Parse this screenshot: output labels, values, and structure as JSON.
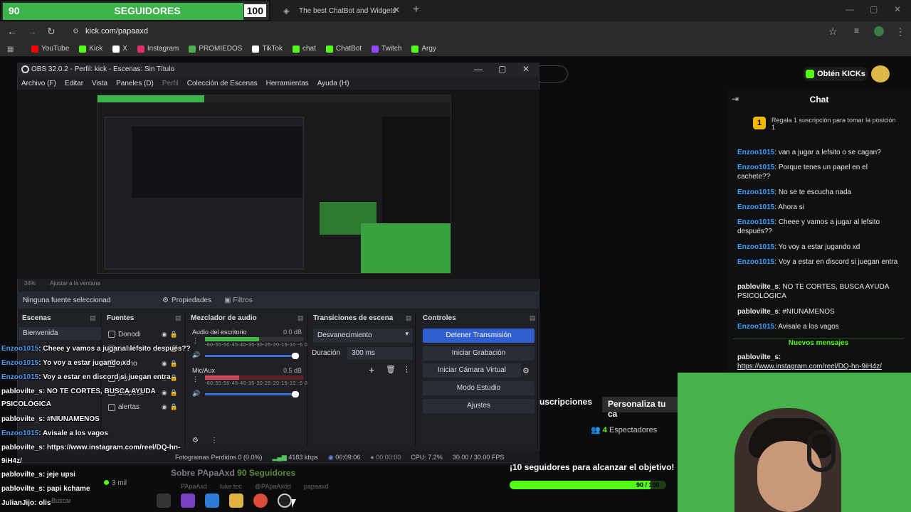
{
  "goal_widget": {
    "current": "90",
    "label": "SEGUIDORES",
    "target": "100",
    "progress_fraction": 0.9
  },
  "browser": {
    "tab_title": "The best ChatBot and Widgets",
    "url": "kick.com/papaaxd",
    "bookmarks": [
      {
        "label": "YouTube",
        "color": "#ff0000"
      },
      {
        "label": "Kick",
        "color": "#53fc18"
      },
      {
        "label": "X",
        "color": "#ffffff"
      },
      {
        "label": "Instagram",
        "color": "#e1306c"
      },
      {
        "label": "PROMIEDOS",
        "color": "#4caf50"
      },
      {
        "label": "TikTok",
        "color": "#ffffff"
      },
      {
        "label": "chat",
        "color": "#53fc18"
      },
      {
        "label": "ChatBot",
        "color": "#53fc18"
      },
      {
        "label": "Twitch",
        "color": "#9146ff"
      },
      {
        "label": "Argy",
        "color": "#53fc18"
      }
    ]
  },
  "kick": {
    "obtain_kicks": "Obtén KICKs",
    "chat_title": "Chat",
    "pinned": {
      "rank": "1",
      "text": "Regala 1 suscripción para tomar la posición 1"
    },
    "messages": [
      {
        "user": "Enzoo1015",
        "text": "van a jugar a lefsito o se cagan?",
        "color": "blue"
      },
      {
        "user": "Enzoo1015",
        "text": "Porque tenes un papel en el cachete??",
        "color": "blue"
      },
      {
        "user": "Enzoo1015",
        "text": "No se te escucha nada",
        "color": "blue"
      },
      {
        "user": "Enzoo1015",
        "text": "Ahora si",
        "color": "blue"
      },
      {
        "user": "Enzoo1015",
        "text": "Cheee y vamos a jugar al lefsito después??",
        "color": "blue"
      },
      {
        "user": "Enzoo1015",
        "text": "Yo voy a estar jugando xd",
        "color": "blue"
      },
      {
        "user": "Enzoo1015",
        "text": "Voy a estar en discord si juegan entra",
        "color": "blue"
      },
      {
        "user": "pablovilte_s",
        "text": "NO TE CORTES, BUSCA AYUDA PSICOLÓGICA",
        "color": "white"
      },
      {
        "user": "pablovilte_s",
        "text": "#NIUNAMENOS",
        "color": "white"
      },
      {
        "user": "Enzoo1015",
        "text": "Avisale a los vagos",
        "color": "blue"
      }
    ],
    "new_messages": "Nuevos mensajes",
    "last_msg": {
      "user": "pablovilte_s:",
      "link": "https://www.instagram.com/reel/DQ-hn-9iH4z/"
    },
    "subs_button": "uscripciones",
    "customize_button": "Personaliza tu ca",
    "spectators": {
      "count": "4",
      "label": "Espectadores"
    },
    "goal_text": "¡10 seguidores para alcanzar el objetivo!",
    "goal_bar": {
      "label": "90 / 100",
      "fraction": 0.9
    },
    "about": {
      "title": "Sobre PApaAxd",
      "followers": "90 Seguidores"
    },
    "socials": [
      "PApaAxd",
      "luke.toc",
      "@PApaAxdd",
      "papaaxd"
    ],
    "viewers_small": "3 mil"
  },
  "obs": {
    "title": "OBS 32.0.2 - Perfil: kick - Escenas: Sin Título",
    "menu": [
      "Archivo (F)",
      "Editar",
      "Vista",
      "Paneles (D)",
      "Perfil",
      "Colección de Escenas",
      "Herramientas",
      "Ayuda (H)"
    ],
    "zoom": "34%",
    "fit_label": "Ajustar a la ventana",
    "no_source": "Ninguna fuente seleccionad",
    "properties": "Propiedades",
    "filters": "Filtros",
    "docks": {
      "scenes": "Escenas",
      "sources": "Fuentes",
      "mixer": "Mezclador de audio",
      "transitions": "Transiciones de escena",
      "controls": "Controles"
    },
    "scene_item": "Bienvenida",
    "sources": [
      {
        "name": "Donodi"
      },
      {
        "name": "anacio"
      },
      {
        "name": "ultimo"
      },
      {
        "name": "jugar"
      },
      {
        "name": "Disposit"
      },
      {
        "name": "alertas"
      }
    ],
    "mixer": [
      {
        "name": "Audio del escritorio",
        "db": "0.0 dB",
        "level": 0.55,
        "ticks": "-60-55-50-45-40-35-30-25-20-15-10 -5 0"
      },
      {
        "name": "Mic/Aux",
        "db": "0.5 dB",
        "level": 0.35,
        "ticks": "-60-55-50-45-40-35-30-25-20-15-10 -5 0"
      }
    ],
    "transition": "Desvanecimiento",
    "duration_label": "Duración",
    "duration_value": "300 ms",
    "controls": [
      {
        "label": "Detener Transmisión",
        "active": true
      },
      {
        "label": "Iniciar Grabación",
        "active": false
      },
      {
        "label": "Iniciar Cámara Virtual",
        "active": false
      },
      {
        "label": "Modo Estudio",
        "active": false
      },
      {
        "label": "Ajustes",
        "active": false
      }
    ],
    "status": {
      "dropped": "Fotogramas Perdidos 0 (0.0%)",
      "bitrate": "4183 kbps",
      "stream_time": "00:09:06",
      "rec_time": "00:00:00",
      "cpu": "CPU: 7.2%",
      "fps": "30.00 / 30.00 FPS"
    }
  },
  "overlay_chat": [
    {
      "user": "Enzoo1015",
      "text": ": Cheee y vamos a jugar al lefsito después??"
    },
    {
      "user": "Enzoo1015",
      "text": ": Yo voy a estar jugando xd"
    },
    {
      "user": "Enzoo1015",
      "text": ": Voy a estar en discord si juegan entra"
    },
    {
      "user": "pablovilte_s",
      "text": ": NO TE CORTES, BUSCA AYUDA"
    },
    {
      "user": "",
      "text": "PSICOLÓGICA"
    },
    {
      "user": "pablovilte_s",
      "text": ": #NIUNAMENOS"
    },
    {
      "user": "Enzoo1015",
      "text": ": Avisale a los vagos"
    },
    {
      "user": "pablovilte_s",
      "text": ": https://www.instagram.com/reel/DQ-hn-"
    },
    {
      "user": "",
      "text": "9iH4z/"
    },
    {
      "user": "pablovilte_s",
      "text": ": jeje upsi"
    },
    {
      "user": "pablovilte_s",
      "text": ": papi kchame"
    },
    {
      "user": "JulianJijo",
      "text": ": olis"
    }
  ],
  "taskbar": {
    "search": "Buscar"
  }
}
